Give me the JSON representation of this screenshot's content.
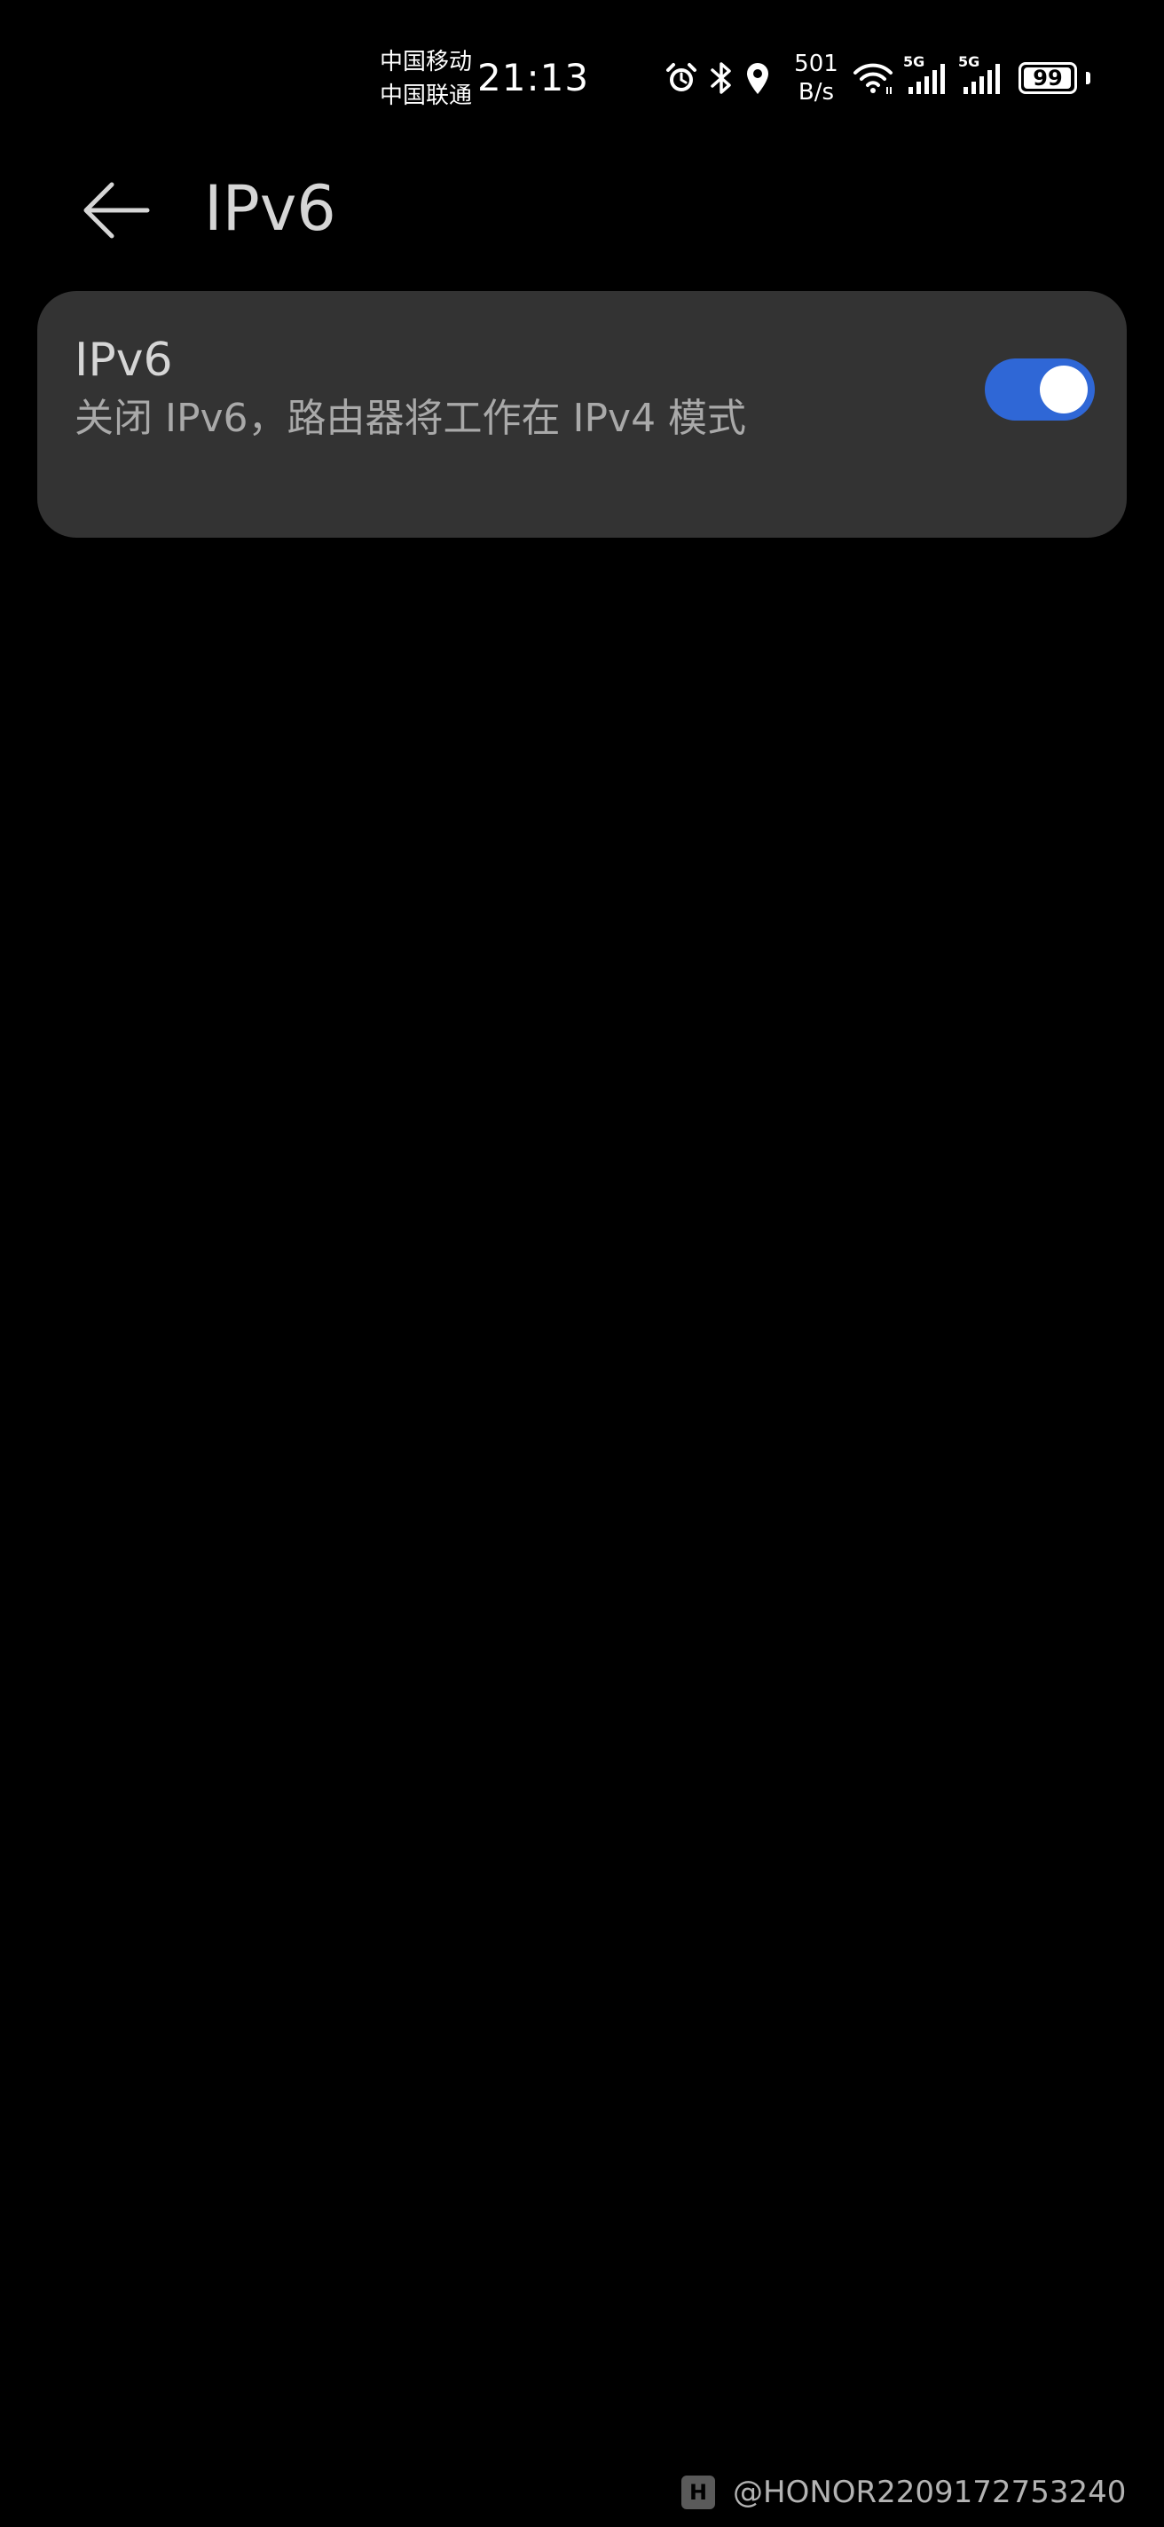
{
  "status_bar": {
    "carrier_1": "中国移动",
    "carrier_2": "中国联通",
    "time": "21:13",
    "net_speed_value": "501",
    "net_speed_unit": "B/s",
    "sim1_tech": "5G",
    "sim2_tech": "5G",
    "battery_level": "99",
    "battery_fraction": 0.99,
    "icons": [
      "alarm-icon",
      "bluetooth-icon",
      "location-icon",
      "wifi-icon",
      "signal-icon",
      "signal-icon",
      "battery-icon"
    ]
  },
  "app_bar": {
    "back_icon": "arrow-left-icon",
    "title": "IPv6"
  },
  "settings": {
    "ipv6": {
      "title": "IPv6",
      "subtitle": "关闭 IPv6，路由器将工作在 IPv4 模式",
      "enabled": true,
      "accent_color": "#2f67d6"
    }
  },
  "watermark": {
    "text": "@HONOR2209172753240"
  }
}
